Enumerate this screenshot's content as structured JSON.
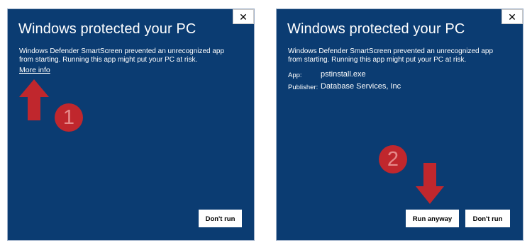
{
  "colors": {
    "panel_bg": "#0b3c72",
    "annotation_red": "#c0272d"
  },
  "left_dialog": {
    "close_label": "✕",
    "title": "Windows protected your PC",
    "message": "Windows Defender SmartScreen prevented an unrecognized app from starting. Running this app might put your PC at risk.",
    "more_info_link": "More info",
    "dont_run_label": "Don't run",
    "step_number": "1",
    "arrow_icon": "arrow-up-icon"
  },
  "right_dialog": {
    "close_label": "✕",
    "title": "Windows protected your PC",
    "message": "Windows Defender SmartScreen prevented an unrecognized app from starting. Running this app might put your PC at risk.",
    "app_label": "App:",
    "app_value": "pstinstall.exe",
    "publisher_label": "Publisher:",
    "publisher_value": "Database Services, Inc",
    "run_anyway_label": "Run anyway",
    "dont_run_label": "Don't run",
    "step_number": "2",
    "arrow_icon": "arrow-down-icon"
  }
}
